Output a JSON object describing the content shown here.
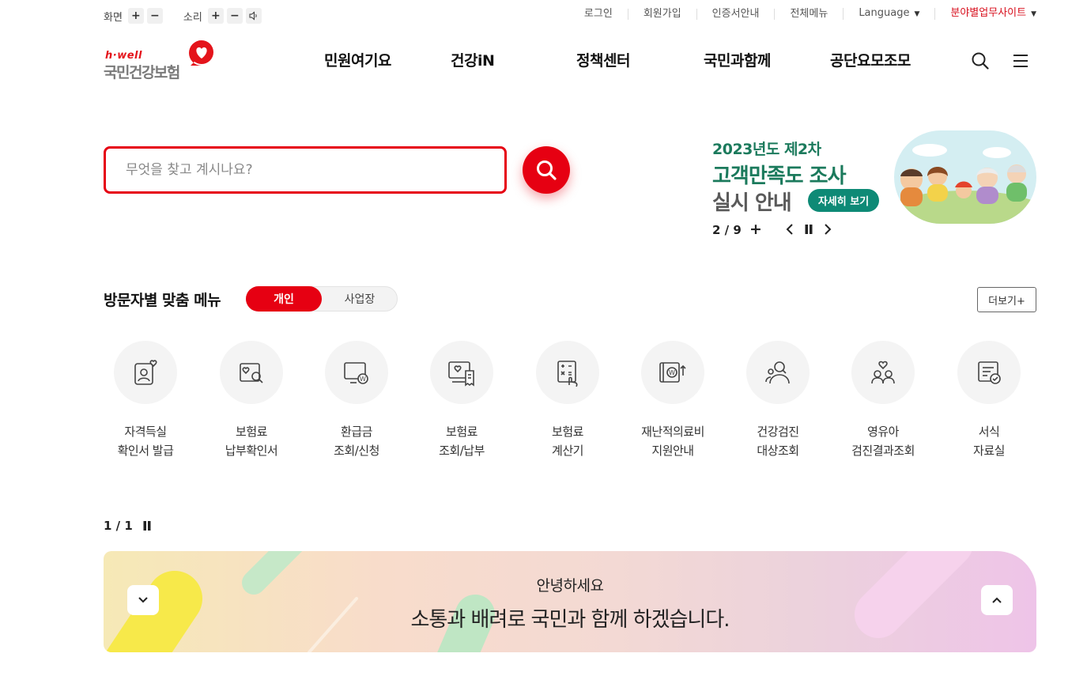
{
  "utility": {
    "screen_label": "화면",
    "sound_label": "소리",
    "plus": "+",
    "minus": "−",
    "links": [
      "로그인",
      "회원가입",
      "인증서안내",
      "전체메뉴"
    ],
    "language": "Language",
    "field_sites": "분야별업무사이트"
  },
  "logo": {
    "brand": "h·well",
    "name": "국민건강보험"
  },
  "gnb": [
    "민원여기요",
    "건강iN",
    "정책센터",
    "국민과함께",
    "공단요모조모"
  ],
  "search": {
    "placeholder": "무엇을 찾고 계시나요?"
  },
  "banner": {
    "line1": "2023년도 제2차",
    "line2": "고객만족도 조사",
    "line3": "실시 안내",
    "more": "자세히 보기",
    "page": "2 / 9",
    "plus": "+"
  },
  "visitor_menu": {
    "title": "방문자별 맞춤 메뉴",
    "tabs": [
      "개인",
      "사업장"
    ],
    "more": "더보기+",
    "items": [
      {
        "l1": "자격득실",
        "l2": "확인서 발급",
        "icon": "id-card-heart-icon"
      },
      {
        "l1": "보험료",
        "l2": "납부확인서",
        "icon": "search-document-icon"
      },
      {
        "l1": "환급금",
        "l2": "조회/신청",
        "icon": "monitor-won-icon"
      },
      {
        "l1": "보험료",
        "l2": "조회/납부",
        "icon": "monitor-receipt-icon"
      },
      {
        "l1": "보험료",
        "l2": "계산기",
        "icon": "calculator-icon"
      },
      {
        "l1": "재난적의료비",
        "l2": "지원안내",
        "icon": "wallet-won-icon"
      },
      {
        "l1": "건강검진",
        "l2": "대상조회",
        "icon": "person-search-icon"
      },
      {
        "l1": "영유아",
        "l2": "검진결과조회",
        "icon": "family-heart-icon"
      },
      {
        "l1": "서식",
        "l2": "자료실",
        "icon": "document-check-icon"
      }
    ],
    "page": "1 / 1"
  },
  "greeting": {
    "small": "안녕하세요",
    "big": "소통과 배려로 국민과 함께 하겠습니다."
  },
  "colors": {
    "accent": "#e60012",
    "banner_green": "#1b7a5c",
    "banner_button": "#0e8a76"
  }
}
